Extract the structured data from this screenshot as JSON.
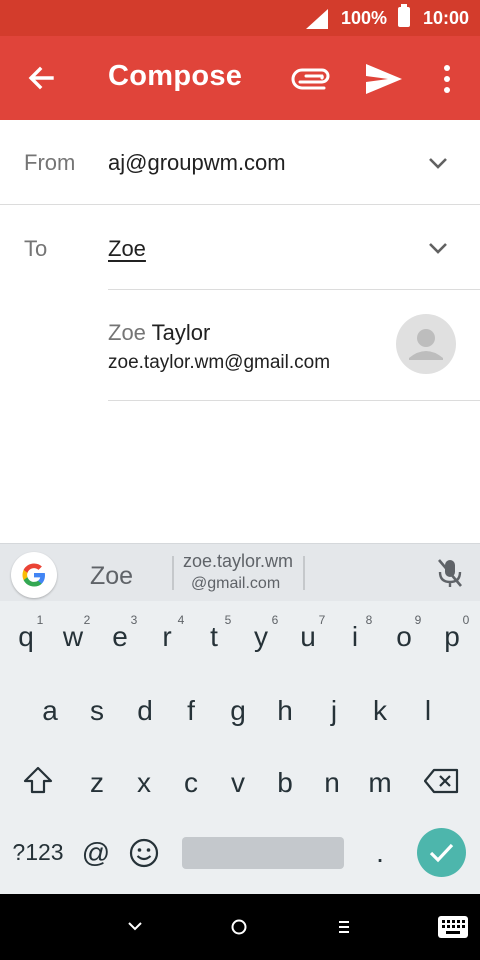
{
  "status_bar": {
    "battery": "100%",
    "time": "10:00"
  },
  "app_bar": {
    "title": "Compose",
    "color": "#e0443a"
  },
  "form": {
    "from_label": "From",
    "from_value": "aj@groupwm.com",
    "to_label": "To",
    "to_value": "Zoe"
  },
  "suggestion": {
    "name_match": "Zoe",
    "name_rest": " Taylor",
    "email": "zoe.taylor.wm@gmail.com"
  },
  "keyboard": {
    "strip": {
      "word": "Zoe",
      "email_line1": "zoe.taylor.wm",
      "email_line2": "@gmail.com"
    },
    "row1": [
      {
        "k": "q",
        "h": "1"
      },
      {
        "k": "w",
        "h": "2"
      },
      {
        "k": "e",
        "h": "3"
      },
      {
        "k": "r",
        "h": "4"
      },
      {
        "k": "t",
        "h": "5"
      },
      {
        "k": "y",
        "h": "6"
      },
      {
        "k": "u",
        "h": "7"
      },
      {
        "k": "i",
        "h": "8"
      },
      {
        "k": "o",
        "h": "9"
      },
      {
        "k": "p",
        "h": "0"
      }
    ],
    "row2": [
      "a",
      "s",
      "d",
      "f",
      "g",
      "h",
      "j",
      "k",
      "l"
    ],
    "row3": [
      "z",
      "x",
      "c",
      "v",
      "b",
      "n",
      "m"
    ],
    "symbols_key": "?123",
    "at_key": "@",
    "period_key": ".",
    "enter_color": "#4db6ac"
  }
}
